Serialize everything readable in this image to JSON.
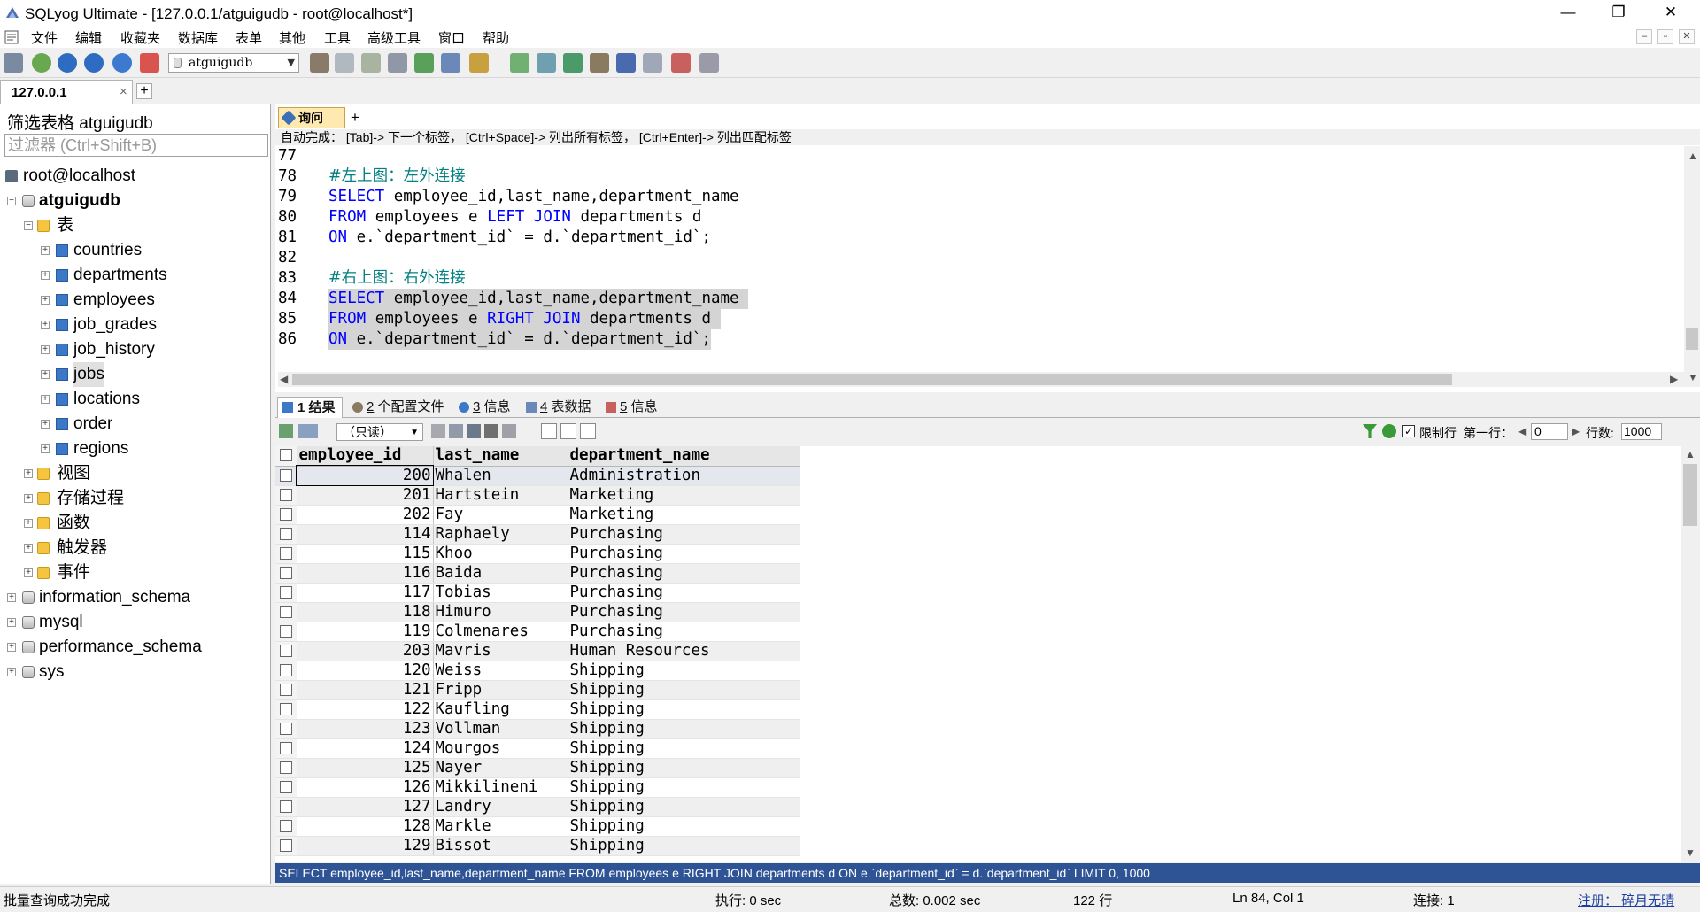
{
  "window": {
    "title": "SQLyog Ultimate - [127.0.0.1/atguigudb - root@localhost*]",
    "min": "—",
    "max": "❐",
    "close": "✕"
  },
  "menu": [
    "文件",
    "编辑",
    "收藏夹",
    "数据库",
    "表单",
    "其他",
    "工具",
    "高级工具",
    "窗口",
    "帮助"
  ],
  "mdi": [
    "–",
    "▫",
    "✕"
  ],
  "toolbar": {
    "db_select": "atguigudb"
  },
  "conn_tab": {
    "label": "127.0.0.1",
    "close": "×",
    "add": "+"
  },
  "left": {
    "filter_label": "筛选表格 atguigudb",
    "filter_placeholder": "过滤器 (Ctrl+Shift+B)",
    "root": "root@localhost",
    "db": "atguigudb",
    "tables_folder": "表",
    "tables": [
      "countries",
      "departments",
      "employees",
      "job_grades",
      "job_history",
      "jobs",
      "locations",
      "order",
      "regions"
    ],
    "folders": [
      "视图",
      "存储过程",
      "函数",
      "触发器",
      "事件"
    ],
    "other_dbs": [
      "information_schema",
      "mysql",
      "performance_schema",
      "sys"
    ],
    "exp_minus": "−",
    "exp_plus": "+"
  },
  "editor": {
    "tab_label": "询问",
    "tab_add": "+",
    "hint": "自动完成： [Tab]-> 下一个标签， [Ctrl+Space]-> 列出所有标签， [Ctrl+Enter]-> 列出匹配标签",
    "line_numbers": [
      "77",
      "78",
      "79",
      "80",
      "81",
      "82",
      "83",
      "84",
      "85",
      "86"
    ],
    "l78": "#左上图：左外连接",
    "l79_kw": "SELECT",
    "l79_rest": " employee_id,last_name,department_name",
    "l80_kw1": "FROM",
    "l80_mid": " employees e ",
    "l80_kw2": "LEFT JOIN",
    "l80_rest": " departments d",
    "l81_kw": "ON",
    "l81_rest": " e.`department_id` = d.`department_id`;",
    "l83": "#右上图：右外连接",
    "l84_kw": "SELECT",
    "l84_rest": " employee_id,last_name,department_name ",
    "l85_kw1": "FROM",
    "l85_mid": " employees e ",
    "l85_kw2": "RIGHT JOIN",
    "l85_rest": " departments d ",
    "l86_kw": "ON",
    "l86_rest": " e.`department_id` = d.`department_id`;"
  },
  "result_tabs": [
    {
      "num": "1",
      "label": " 结果"
    },
    {
      "num": "2",
      "label": " 个配置文件"
    },
    {
      "num": "3",
      "label": " 信息"
    },
    {
      "num": "4",
      "label": " 表数据"
    },
    {
      "num": "5",
      "label": " 信息"
    }
  ],
  "result_toolbar": {
    "mode": "（只读）",
    "limit_label": "限制行",
    "first_row_label": "第一行：",
    "first_row": "0",
    "rows_label": "行数:",
    "rows": "1000"
  },
  "grid": {
    "columns": [
      "employee_id",
      "last_name",
      "department_name"
    ],
    "rows": [
      [
        "200",
        "Whalen",
        "Administration"
      ],
      [
        "201",
        "Hartstein",
        "Marketing"
      ],
      [
        "202",
        "Fay",
        "Marketing"
      ],
      [
        "114",
        "Raphaely",
        "Purchasing"
      ],
      [
        "115",
        "Khoo",
        "Purchasing"
      ],
      [
        "116",
        "Baida",
        "Purchasing"
      ],
      [
        "117",
        "Tobias",
        "Purchasing"
      ],
      [
        "118",
        "Himuro",
        "Purchasing"
      ],
      [
        "119",
        "Colmenares",
        "Purchasing"
      ],
      [
        "203",
        "Mavris",
        "Human Resources"
      ],
      [
        "120",
        "Weiss",
        "Shipping"
      ],
      [
        "121",
        "Fripp",
        "Shipping"
      ],
      [
        "122",
        "Kaufling",
        "Shipping"
      ],
      [
        "123",
        "Vollman",
        "Shipping"
      ],
      [
        "124",
        "Mourgos",
        "Shipping"
      ],
      [
        "125",
        "Nayer",
        "Shipping"
      ],
      [
        "126",
        "Mikkilineni",
        "Shipping"
      ],
      [
        "127",
        "Landry",
        "Shipping"
      ],
      [
        "128",
        "Markle",
        "Shipping"
      ],
      [
        "129",
        "Bissot",
        "Shipping"
      ]
    ]
  },
  "sql_status": "SELECT employee_id,last_name,department_name FROM employees e RIGHT JOIN departments d ON e.`department_id` = d.`department_id` LIMIT 0, 1000",
  "status": {
    "msg": "批量查询成功完成",
    "exec": "执行: 0 sec",
    "total": "总数: 0.002 sec",
    "rows": "122 行",
    "pos": "Ln 84, Col 1",
    "conn": "连接: 1",
    "reg": "注册： 碎月无晴"
  },
  "colors": {
    "accent": "#2f5496",
    "keyword": "#0000ff",
    "comment": "#008080",
    "tab_active": "#ffe9b0"
  }
}
